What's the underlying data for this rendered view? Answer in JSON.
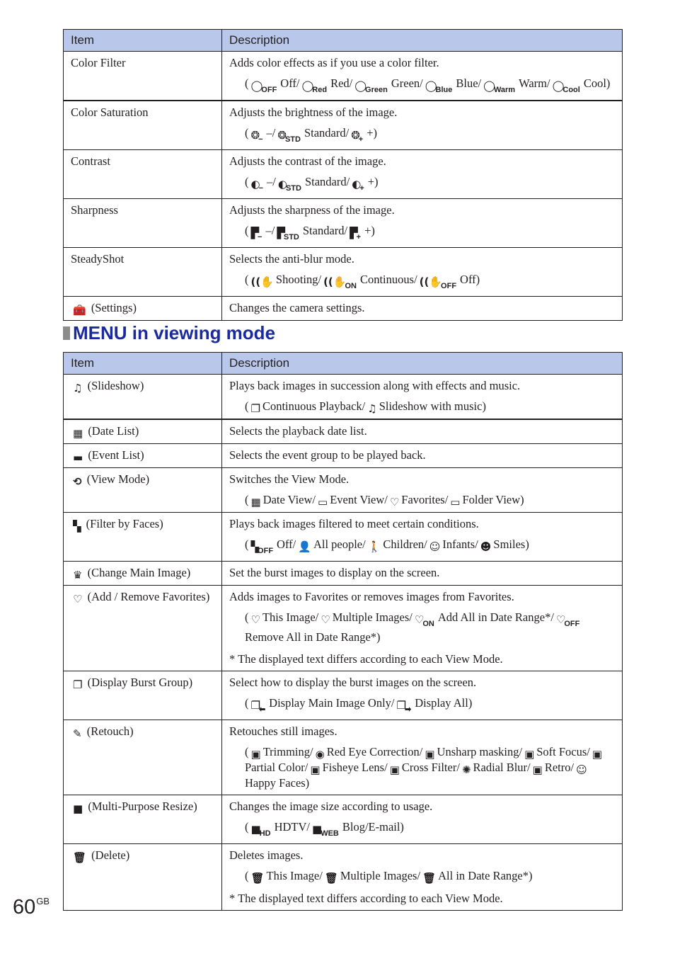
{
  "table_headers": {
    "item": "Item",
    "description": "Description"
  },
  "shooting_menu": [
    {
      "item": "Color Filter",
      "item_icon": "",
      "description": "Adds color effects as if you use a color filter.",
      "options": [
        {
          "icon": "color-filter-off-icon",
          "glyph": "◯",
          "sub": "OFF",
          "label": "Off/"
        },
        {
          "icon": "color-filter-red-icon",
          "glyph": "◯",
          "sub": "Red",
          "label": "Red/"
        },
        {
          "icon": "color-filter-green-icon",
          "glyph": "◯",
          "sub": "Green",
          "label": "Green/"
        },
        {
          "icon": "color-filter-blue-icon",
          "glyph": "◯",
          "sub": "Blue",
          "label": "Blue/"
        },
        {
          "icon": "color-filter-warm-icon",
          "glyph": "◯",
          "sub": "Warm",
          "label": "Warm/"
        },
        {
          "icon": "color-filter-cool-icon",
          "glyph": "◯",
          "sub": "Cool",
          "label": "Cool)"
        }
      ]
    },
    {
      "item": "Color Saturation",
      "item_icon": "",
      "description": "Adjusts the brightness of the image.",
      "options": [
        {
          "icon": "saturation-minus-icon",
          "glyph": "❂",
          "sub": "−",
          "label": "–/"
        },
        {
          "icon": "saturation-standard-icon",
          "glyph": "❂",
          "sub": "STD",
          "label": "Standard/"
        },
        {
          "icon": "saturation-plus-icon",
          "glyph": "❂",
          "sub": "+",
          "label": "+)"
        }
      ]
    },
    {
      "item": "Contrast",
      "item_icon": "",
      "description": "Adjusts the contrast of the image.",
      "options": [
        {
          "icon": "contrast-minus-icon",
          "glyph": "◐",
          "sub": "−",
          "label": "–/"
        },
        {
          "icon": "contrast-standard-icon",
          "glyph": "◐",
          "sub": "STD",
          "label": "Standard/"
        },
        {
          "icon": "contrast-plus-icon",
          "glyph": "◐",
          "sub": "+",
          "label": "+)"
        }
      ]
    },
    {
      "item": "Sharpness",
      "item_icon": "",
      "description": "Adjusts the sharpness of the image.",
      "options": [
        {
          "icon": "sharpness-minus-icon",
          "glyph": "▛",
          "sub": "−",
          "label": "–/"
        },
        {
          "icon": "sharpness-standard-icon",
          "glyph": "▛",
          "sub": "STD",
          "label": "Standard/"
        },
        {
          "icon": "sharpness-plus-icon",
          "glyph": "▛",
          "sub": "+",
          "label": "+)"
        }
      ]
    },
    {
      "item": "SteadyShot",
      "item_icon": "",
      "description": "Selects the anti-blur mode.",
      "options": [
        {
          "icon": "steadyshot-shooting-icon",
          "glyph": "((✋",
          "sub": "",
          "label": "Shooting/"
        },
        {
          "icon": "steadyshot-continuous-icon",
          "glyph": "((✋",
          "sub": "ON",
          "label": "Continuous/"
        },
        {
          "icon": "steadyshot-off-icon",
          "glyph": "((✋",
          "sub": "OFF",
          "label": "Off)"
        }
      ]
    },
    {
      "item": "(Settings)",
      "item_icon": "toolbox-icon",
      "item_glyph": "🧰",
      "description": "Changes the camera settings.",
      "options": []
    }
  ],
  "section_title": "MENU in viewing mode",
  "viewing_menu": [
    {
      "item": "(Slideshow)",
      "item_icon": "slideshow-icon",
      "item_glyph": "♫",
      "description": "Plays back images in succession along with effects and music.",
      "options": [
        {
          "icon": "continuous-playback-icon",
          "glyph": "❐",
          "sub": "",
          "label": "Continuous Playback/"
        },
        {
          "icon": "slideshow-music-icon",
          "glyph": "♫",
          "sub": "",
          "label": "Slideshow with music)"
        }
      ]
    },
    {
      "item": "(Date List)",
      "item_icon": "calendar-icon",
      "item_glyph": "▦",
      "description": "Selects the playback date list.",
      "options": []
    },
    {
      "item": "(Event List)",
      "item_icon": "event-list-icon",
      "item_glyph": "▬",
      "description": "Selects the event group to be played back.",
      "options": []
    },
    {
      "item": "(View Mode)",
      "item_icon": "view-mode-icon",
      "item_glyph": "⟲",
      "description": "Switches the View Mode.",
      "options": [
        {
          "icon": "date-view-icon",
          "glyph": "▦",
          "sub": "",
          "label": "Date View/"
        },
        {
          "icon": "event-view-icon",
          "glyph": "▭",
          "sub": "",
          "label": "Event View/"
        },
        {
          "icon": "favorites-icon",
          "glyph": "♡",
          "sub": "",
          "label": "Favorites/"
        },
        {
          "icon": "folder-view-icon",
          "glyph": "▭",
          "sub": "",
          "label": "Folder View)"
        }
      ]
    },
    {
      "item": "(Filter by Faces)",
      "item_icon": "filter-faces-icon",
      "item_glyph": "▚",
      "description": "Plays back images filtered to meet certain conditions.",
      "options": [
        {
          "icon": "filter-off-icon",
          "glyph": "▚",
          "sub": "OFF",
          "label": "Off/"
        },
        {
          "icon": "all-people-icon",
          "glyph": "👤",
          "sub": "",
          "label": "All people/"
        },
        {
          "icon": "children-icon",
          "glyph": "🚶",
          "sub": "",
          "label": "Children/"
        },
        {
          "icon": "infants-icon",
          "glyph": "☺",
          "sub": "",
          "label": "Infants/"
        },
        {
          "icon": "smiles-icon",
          "glyph": "☻",
          "sub": "",
          "label": "Smiles)"
        }
      ]
    },
    {
      "item": "(Change Main Image)",
      "item_icon": "crown-icon",
      "item_glyph": "♛",
      "description": "Set the burst images to display on the screen.",
      "options": []
    },
    {
      "item": "(Add / Remove Favorites)",
      "item_icon": "heart-icon",
      "item_glyph": "♡",
      "description": "Adds images to Favorites or removes images from Favorites.",
      "options": [
        {
          "icon": "favorite-this-image-icon",
          "glyph": "♡",
          "sub": "",
          "label": "This Image/"
        },
        {
          "icon": "favorite-multiple-images-icon",
          "glyph": "♡",
          "sub": "",
          "label": "Multiple Images/"
        },
        {
          "icon": "favorite-add-all-icon",
          "glyph": "♡",
          "sub": "ON",
          "label": "Add All in Date Range*/"
        },
        {
          "icon": "favorite-remove-all-icon",
          "glyph": "♡",
          "sub": "OFF",
          "label": "Remove All in Date Range*)"
        }
      ],
      "note": "* The displayed text differs according to each View Mode."
    },
    {
      "item": "(Display Burst Group)",
      "item_icon": "burst-group-icon",
      "item_glyph": "❐",
      "description": "Select how to display the burst images on the screen.",
      "options": [
        {
          "icon": "display-main-image-icon",
          "glyph": "❐",
          "sub": "⬅",
          "label": "Display Main Image Only/"
        },
        {
          "icon": "display-all-icon",
          "glyph": "❐",
          "sub": "➡",
          "label": "Display All)"
        }
      ]
    },
    {
      "item": "(Retouch)",
      "item_icon": "retouch-icon",
      "item_glyph": "✎",
      "description": "Retouches still images.",
      "options": [
        {
          "icon": "trimming-icon",
          "glyph": "▣",
          "sub": "",
          "label": "Trimming/"
        },
        {
          "icon": "red-eye-icon",
          "glyph": "◉",
          "sub": "",
          "label": "Red Eye Correction/"
        },
        {
          "icon": "unsharp-masking-icon",
          "glyph": "▣",
          "sub": "",
          "label": "Unsharp masking/"
        },
        {
          "icon": "soft-focus-icon",
          "glyph": "▣",
          "sub": "",
          "label": "Soft Focus/"
        },
        {
          "icon": "partial-color-icon",
          "glyph": "▣",
          "sub": "",
          "label": "Partial Color/"
        },
        {
          "icon": "fisheye-icon",
          "glyph": "▣",
          "sub": "",
          "label": "Fisheye Lens/"
        },
        {
          "icon": "cross-filter-icon",
          "glyph": "▣",
          "sub": "",
          "label": "Cross Filter/"
        },
        {
          "icon": "radial-blur-icon",
          "glyph": "✺",
          "sub": "",
          "label": "Radial Blur/"
        },
        {
          "icon": "retro-icon",
          "glyph": "▣",
          "sub": "",
          "label": "Retro/"
        },
        {
          "icon": "happy-faces-icon",
          "glyph": "☺",
          "sub": "",
          "label": "Happy Faces)"
        }
      ]
    },
    {
      "item": "(Multi-Purpose Resize)",
      "item_icon": "resize-icon",
      "item_glyph": "■",
      "description": "Changes the image size according to usage.",
      "options": [
        {
          "icon": "resize-hdtv-icon",
          "glyph": "■",
          "sub": "HD",
          "label": "HDTV/"
        },
        {
          "icon": "resize-web-icon",
          "glyph": "■",
          "sub": "WEB",
          "label": "Blog/E-mail)"
        }
      ]
    },
    {
      "item": "(Delete)",
      "item_icon": "trash-icon",
      "item_glyph": "🗑",
      "description": "Deletes images.",
      "options": [
        {
          "icon": "delete-this-image-icon",
          "glyph": "🗑",
          "sub": "",
          "label": "This Image/"
        },
        {
          "icon": "delete-multiple-images-icon",
          "glyph": "🗑",
          "sub": "",
          "label": "Multiple Images/"
        },
        {
          "icon": "delete-date-range-icon",
          "glyph": "🗑",
          "sub": "",
          "label": "All in Date Range*)"
        }
      ],
      "note": "* The displayed text differs according to each View Mode."
    }
  ],
  "page": {
    "number": "60",
    "suffix": "GB"
  },
  "colors": {
    "header_bg": "#b8c7ea",
    "section_title": "#1b2a9e"
  }
}
